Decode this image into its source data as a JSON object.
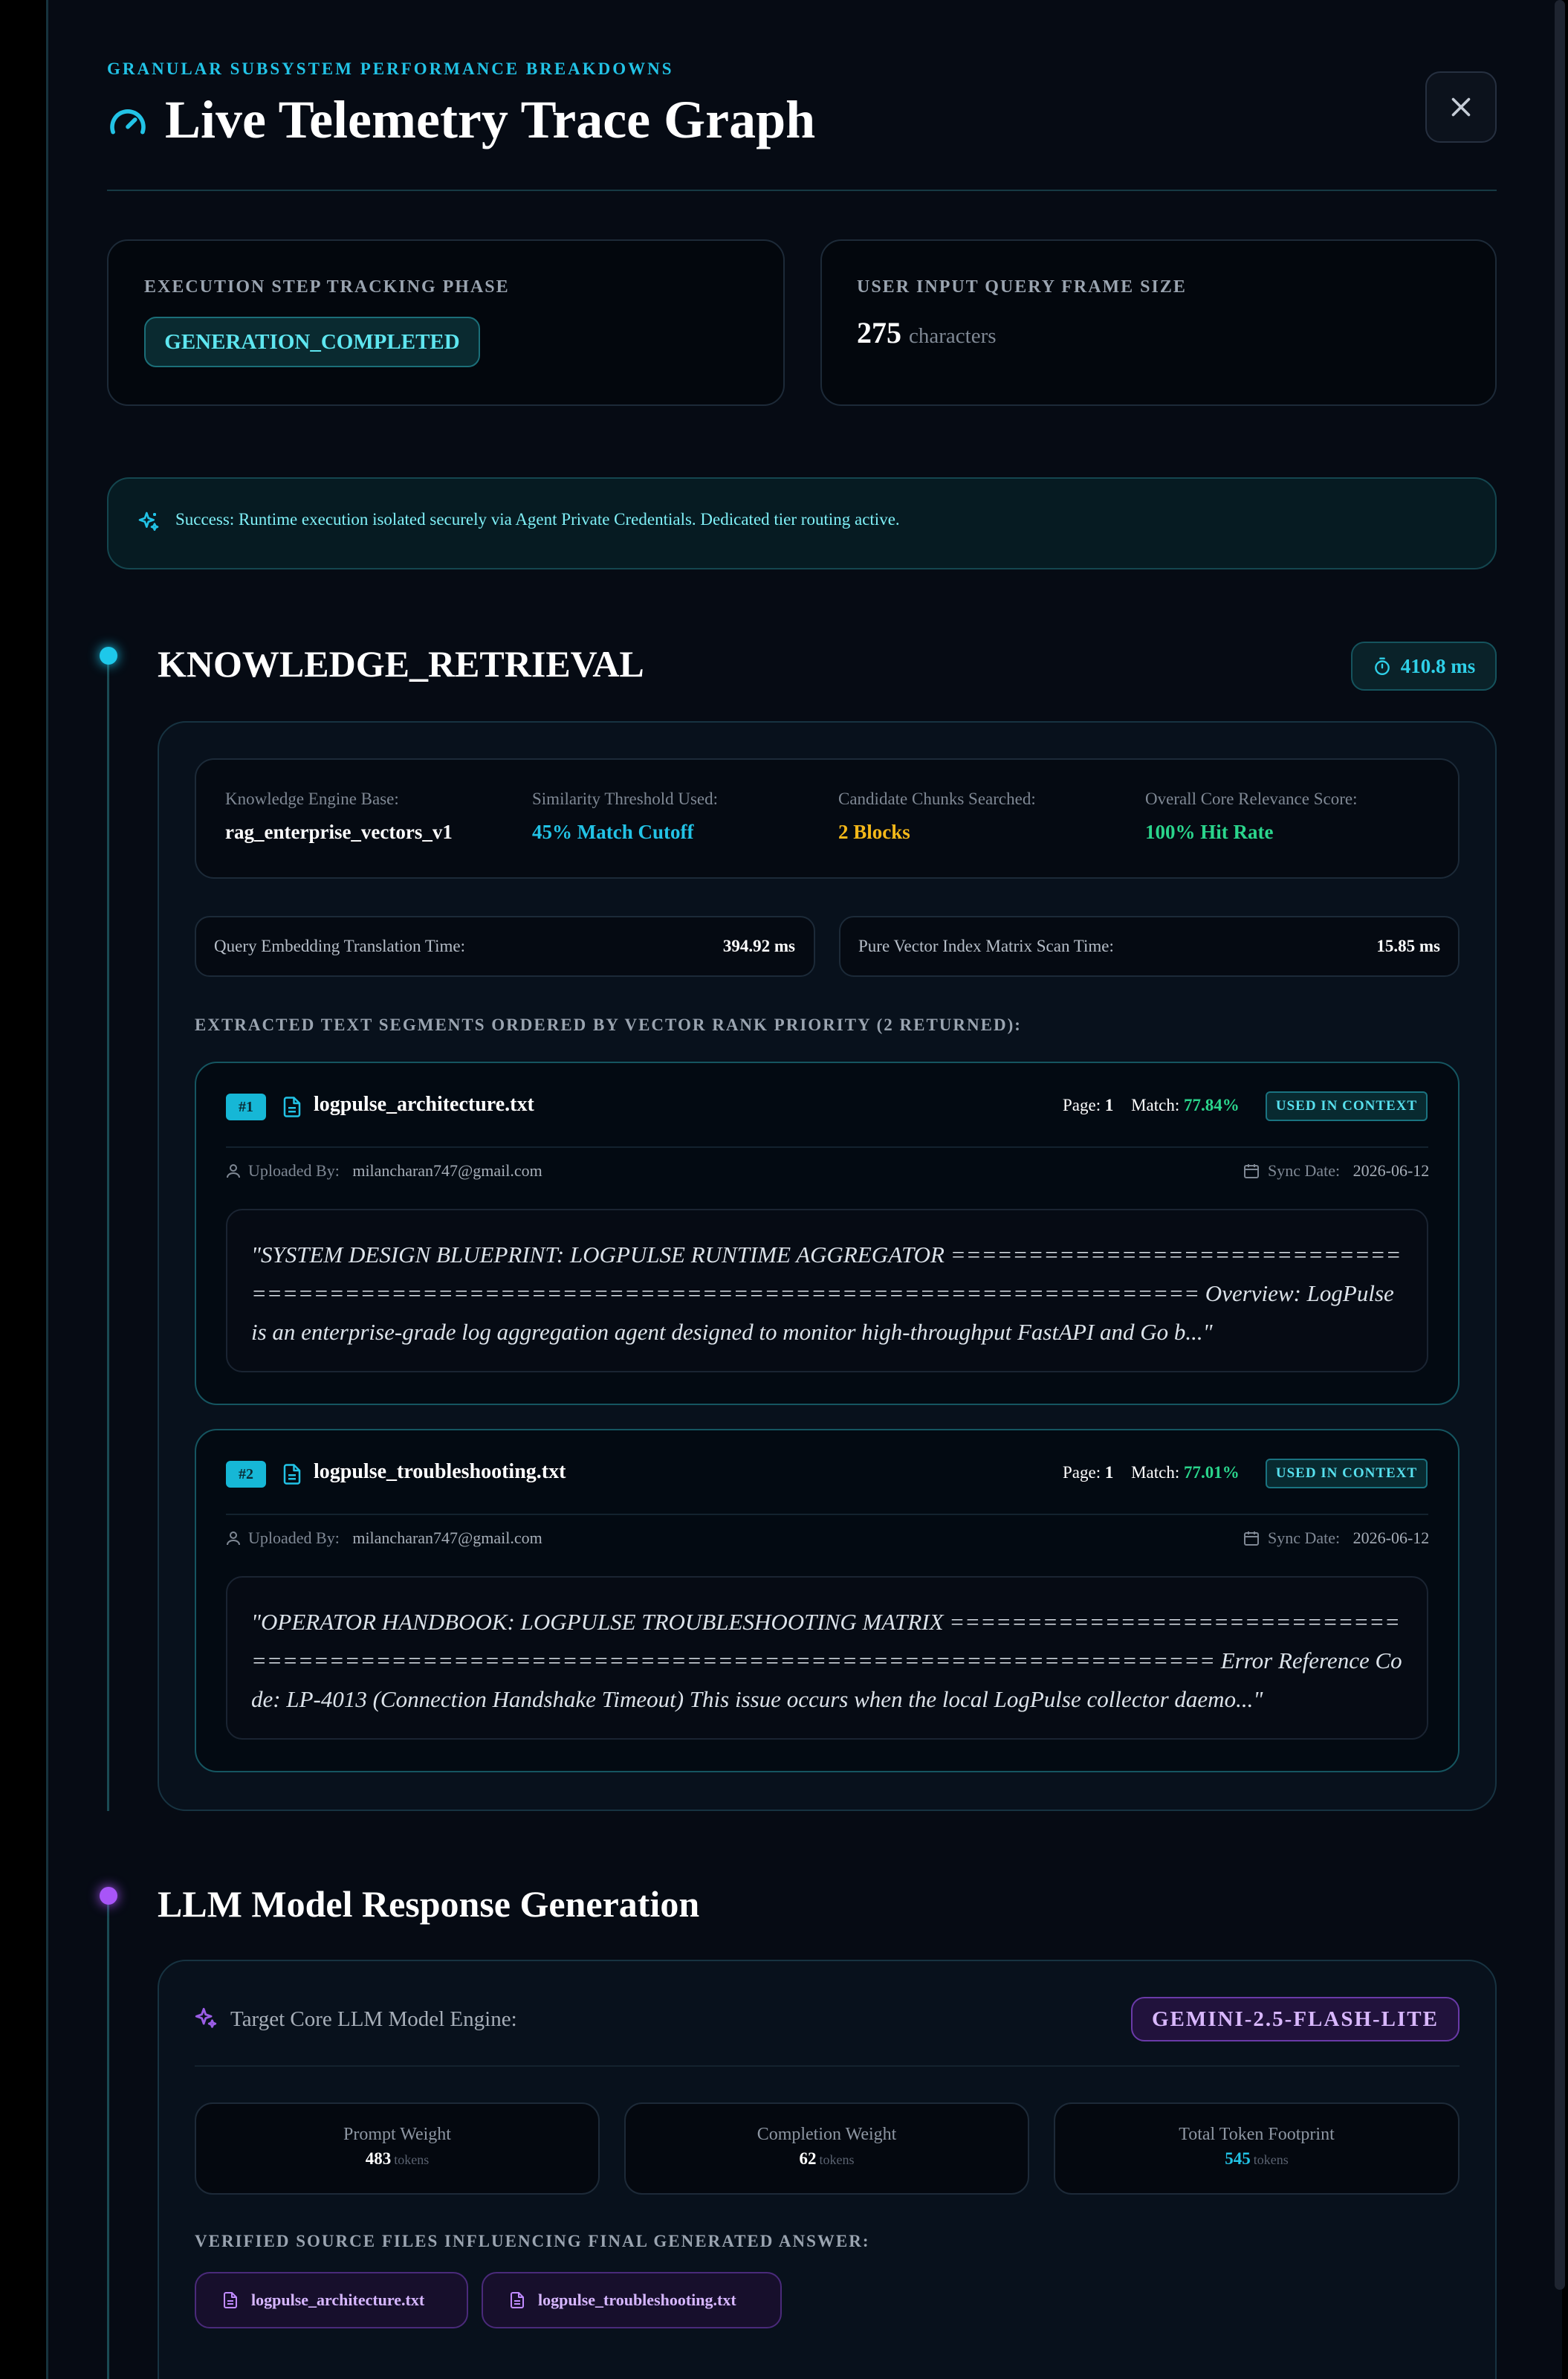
{
  "header": {
    "eyebrow": "GRANULAR SUBSYSTEM PERFORMANCE BREAKDOWNS",
    "title": "Live Telemetry Trace Graph"
  },
  "stats": {
    "phase_label": "EXECUTION STEP TRACKING PHASE",
    "phase_value": "GENERATION_COMPLETED",
    "query_label": "USER INPUT QUERY FRAME SIZE",
    "query_count": "275",
    "query_unit": "characters"
  },
  "banner": {
    "text": "Success: Runtime execution isolated securely via Agent Private Credentials. Dedicated tier routing active."
  },
  "retrieval": {
    "title": "KNOWLEDGE_RETRIEVAL",
    "duration": "410.8 ms",
    "metrics": [
      {
        "label": "Knowledge Engine Base:",
        "value": "rag_enterprise_vectors_v1"
      },
      {
        "label": "Similarity Threshold Used:",
        "value": "45% Match Cutoff"
      },
      {
        "label": "Candidate Chunks Searched:",
        "value": "2 Blocks"
      },
      {
        "label": "Overall Core Relevance Score:",
        "value": "100% Hit Rate"
      }
    ],
    "embedding_label": "Query Embedding Translation Time:",
    "embedding_value": "394.92 ms",
    "scan_label": "Pure Vector Index Matrix Scan Time:",
    "scan_value": "15.85 ms",
    "segments_heading": "EXTRACTED TEXT SEGMENTS ORDERED BY VECTOR RANK PRIORITY (2 RETURNED):",
    "chunks": [
      {
        "rank": "#1",
        "filename": "logpulse_architecture.txt",
        "page_label": "Page:",
        "page": "1",
        "match_label": "Match:",
        "match": "77.84%",
        "badge": "USED IN CONTEXT",
        "uploaded_label": "Uploaded By:",
        "uploaded_by": "milancharan747@gmail.com",
        "sync_label": "Sync Date:",
        "sync_date": "2026-06-12",
        "excerpt": "\"SYSTEM DESIGN BLUEPRINT: LOGPULSE RUNTIME AGGREGATOR ========================================================================================== Overview: LogPulse is an enterprise-grade log aggregation agent designed to monitor high-throughput FastAPI and Go b...\""
      },
      {
        "rank": "#2",
        "filename": "logpulse_troubleshooting.txt",
        "page_label": "Page:",
        "page": "1",
        "match_label": "Match:",
        "match": "77.01%",
        "badge": "USED IN CONTEXT",
        "uploaded_label": "Uploaded By:",
        "uploaded_by": "milancharan747@gmail.com",
        "sync_label": "Sync Date:",
        "sync_date": "2026-06-12",
        "excerpt": "\"OPERATOR HANDBOOK: LOGPULSE TROUBLESHOOTING MATRIX =========================================================================================== Error Reference Code: LP-4013 (Connection Handshake Timeout) This issue occurs when the local LogPulse collector daemo...\""
      }
    ]
  },
  "llm": {
    "title": "LLM Model Response Generation",
    "engine_label": "Target Core LLM Model Engine:",
    "engine": "GEMINI-2.5-FLASH-LITE",
    "tokens": [
      {
        "label": "Prompt Weight",
        "value": "483",
        "unit": "tokens"
      },
      {
        "label": "Completion Weight",
        "value": "62",
        "unit": "tokens"
      },
      {
        "label": "Total Token Footprint",
        "value": "545",
        "unit": "tokens"
      }
    ],
    "sources_heading": "VERIFIED SOURCE FILES INFLUENCING FINAL GENERATED ANSWER:",
    "sources": [
      "logpulse_architecture.txt",
      "logpulse_troubleshooting.txt"
    ]
  },
  "colors": {
    "accent_cyan": "#22c3e6",
    "accent_yellow": "#f5b819",
    "accent_green": "#2ad58c",
    "accent_purple": "#a855f7"
  }
}
